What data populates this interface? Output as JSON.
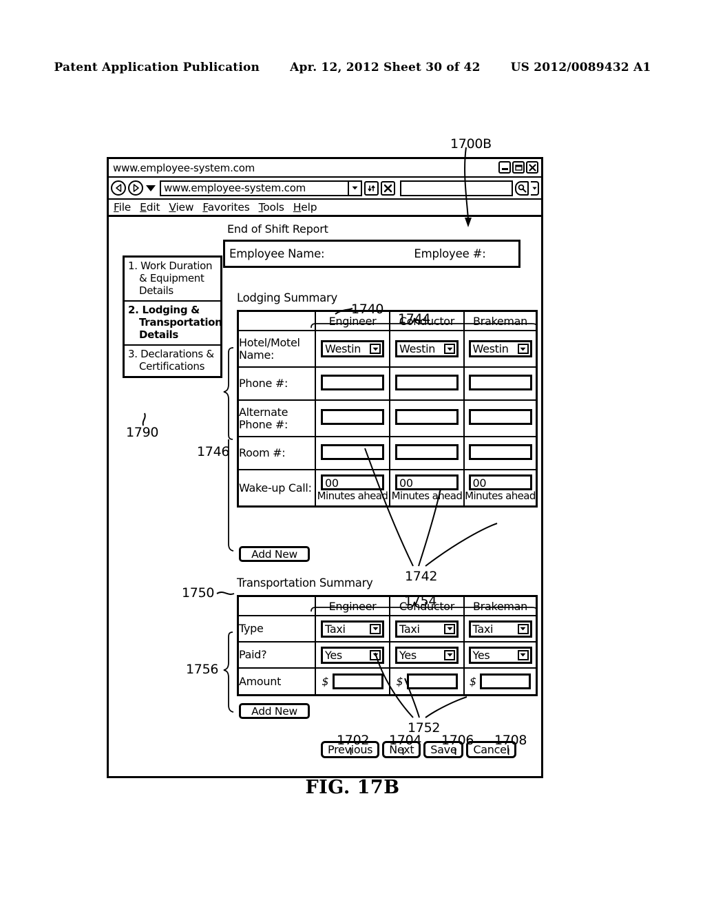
{
  "patent_header": {
    "publication": "Patent Application Publication",
    "date_sheet": "Apr. 12, 2012  Sheet 30 of 42",
    "number": "US 2012/0089432 A1"
  },
  "figure": {
    "caption": "FIG. 17B",
    "window_ref": "1700B"
  },
  "browser": {
    "title": "www.employee-system.com",
    "url_value": "www.employee-system.com",
    "search_value": "",
    "menu": [
      "File",
      "Edit",
      "View",
      "Favorites",
      "Tools",
      "Help"
    ],
    "icons": {
      "back": "back-arrow-icon",
      "forward": "forward-arrow-icon",
      "history_dropdown": "chevron-down-icon",
      "url_dropdown": "chevron-down-icon",
      "refresh": "refresh-icon",
      "stop": "stop-icon",
      "search": "magnifier-icon",
      "search_dropdown": "chevron-down-icon",
      "minimize": "minimize-icon",
      "restore": "restore-icon",
      "close": "close-icon"
    }
  },
  "page": {
    "report_title": "End of Shift Report",
    "employee_name_label": "Employee Name:",
    "employee_number_label": "Employee #:"
  },
  "sidebar": {
    "ref": "1790",
    "items": [
      {
        "label": "1. Work Duration & Equipment Details",
        "active": false
      },
      {
        "label": "2. Lodging & Transportation Details",
        "active": true
      },
      {
        "label": "3. Declarations & Certifications",
        "active": false
      }
    ]
  },
  "lodging": {
    "title": "Lodging Summary",
    "title_ref": "1740",
    "columns_ref": "1744",
    "rows_ref": "1746",
    "fields_ref": "1742",
    "columns": [
      "Engineer",
      "Conductor",
      "Brakeman"
    ],
    "rows": [
      {
        "label": "Hotel/Motel Name:",
        "type": "select",
        "values": [
          "Westin",
          "Westin",
          "Westin"
        ]
      },
      {
        "label": "Phone #:",
        "type": "input",
        "values": [
          "",
          "",
          ""
        ]
      },
      {
        "label": "Alternate Phone #:",
        "type": "input",
        "values": [
          "",
          "",
          ""
        ]
      },
      {
        "label": "Room #:",
        "type": "input",
        "values": [
          "",
          "",
          ""
        ]
      },
      {
        "label": "Wake-up Call:",
        "type": "input-sub",
        "values": [
          "00",
          "00",
          "00"
        ],
        "sub_labels": [
          "Minutes ahead",
          "Minutes ahead",
          "Minutes ahead"
        ]
      }
    ],
    "add_new_label": "Add New"
  },
  "transportation": {
    "title": "Transportation Summary",
    "title_ref": "1750",
    "columns_ref": "1754",
    "rows_ref": "1756",
    "fields_ref": "1752",
    "columns": [
      "Engineer",
      "Conductor",
      "Brakeman"
    ],
    "rows": [
      {
        "label": "Type",
        "type": "select",
        "values": [
          "Taxi",
          "Taxi",
          "Taxi"
        ]
      },
      {
        "label": "Paid?",
        "type": "select",
        "values": [
          "Yes",
          "Yes",
          "Yes"
        ]
      },
      {
        "label": "Amount",
        "type": "currency",
        "prefix": "$",
        "values": [
          "",
          "",
          ""
        ]
      }
    ],
    "add_new_label": "Add New"
  },
  "footer_buttons": [
    {
      "label": "Previous",
      "ref": "1702"
    },
    {
      "label": "Next",
      "ref": "1704"
    },
    {
      "label": "Save",
      "ref": "1706"
    },
    {
      "label": "Cancel",
      "ref": "1708"
    }
  ]
}
